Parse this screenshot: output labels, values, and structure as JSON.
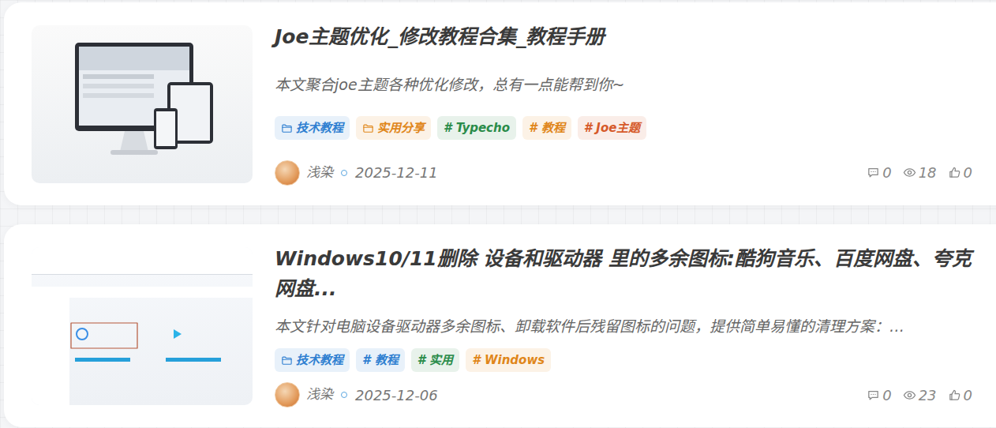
{
  "posts": [
    {
      "title": "Joe主题优化_修改教程合集_教程手册",
      "excerpt": "本文聚合joe主题各种优化修改，总有一点能帮到你~",
      "tags": [
        {
          "label": "技术教程",
          "kind": "category",
          "color": "#2f7fd1"
        },
        {
          "label": "实用分享",
          "kind": "category",
          "color": "#e0861a"
        },
        {
          "label": "# Typecho",
          "kind": "tag",
          "color": "#2a8c4a"
        },
        {
          "label": "# 教程",
          "kind": "tag",
          "color": "#e0861a"
        },
        {
          "label": "# Joe主题",
          "kind": "tag",
          "color": "#d65a2a"
        }
      ],
      "author": "浅染",
      "date": "2025-12-11",
      "comments": "0",
      "views": "18",
      "likes": "0"
    },
    {
      "title": "Windows10/11删除 设备和驱动器 里的多余图标:酷狗音乐、百度网盘、夸克网盘...",
      "excerpt": "本文针对电脑设备驱动器多余图标、卸载软件后残留图标的问题，提供简单易懂的清理方案：…",
      "tags": [
        {
          "label": "技术教程",
          "kind": "category",
          "color": "#2f7fd1"
        },
        {
          "label": "# 教程",
          "kind": "tag",
          "color": "#2f7fd1"
        },
        {
          "label": "# 实用",
          "kind": "tag",
          "color": "#2a8c4a"
        },
        {
          "label": "# Windows",
          "kind": "tag",
          "color": "#e0861a"
        }
      ],
      "author": "浅染",
      "date": "2025-12-06",
      "comments": "0",
      "views": "23",
      "likes": "0"
    }
  ]
}
